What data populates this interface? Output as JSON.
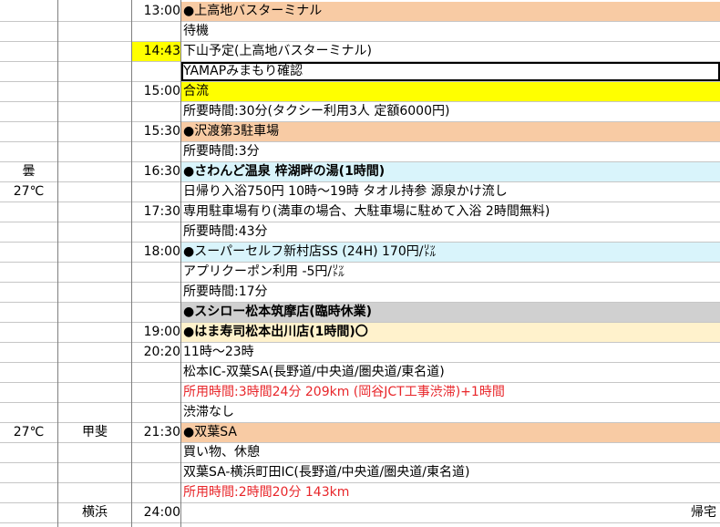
{
  "sheet": {
    "rows": [
      {
        "c1": "",
        "c2": "",
        "time": "13:00",
        "text": "●上高地バスターミナル",
        "fill": "#f8cba4",
        "bold": false
      },
      {
        "c1": "",
        "c2": "",
        "time": "",
        "text": "待機",
        "fill": "",
        "bold": false
      },
      {
        "c1": "",
        "c2": "",
        "time": "14:43",
        "time_fill": "#ffff00",
        "text": "下山予定(上高地バスターミナル)",
        "fill": "",
        "bold": false
      },
      {
        "c1": "",
        "c2": "",
        "time": "",
        "text": "YAMAPみまもり確認",
        "fill": "",
        "bold": false,
        "boxed": true
      },
      {
        "c1": "",
        "c2": "",
        "time": "15:00",
        "text": "合流",
        "fill": "#ffff00",
        "bold": false
      },
      {
        "c1": "",
        "c2": "",
        "time": "",
        "text": "所要時間:30分(タクシー利用3人 定額6000円)",
        "fill": "",
        "bold": false
      },
      {
        "c1": "",
        "c2": "",
        "time": "15:30",
        "text": "●沢渡第3駐車場",
        "fill": "#f8cba4",
        "bold": false
      },
      {
        "c1": "",
        "c2": "",
        "time": "",
        "text": "所要時間:3分",
        "fill": "",
        "bold": false
      },
      {
        "c1": "曇",
        "c2": "",
        "time": "16:30",
        "text": "●さわんど温泉 梓湖畔の湯(1時間)",
        "fill": "#d9f4fb",
        "bold": true
      },
      {
        "c1": "27℃",
        "c2": "",
        "time": "",
        "text": "日帰り入浴750円 10時〜19時 タオル持参 源泉かけ流し",
        "fill": "",
        "bold": false
      },
      {
        "c1": "",
        "c2": "",
        "time": "17:30",
        "text": "専用駐車場有り(満車の場合、大駐車場に駐めて入浴 2時間無料)",
        "fill": "",
        "bold": false
      },
      {
        "c1": "",
        "c2": "",
        "time": "",
        "text": "所要時間:43分",
        "fill": "",
        "bold": false
      },
      {
        "c1": "",
        "c2": "",
        "time": "18:00",
        "text": "●スーパーセルフ新村店SS (24H) 170円/㍑",
        "fill": "#d9f4fb",
        "bold": false
      },
      {
        "c1": "",
        "c2": "",
        "time": "",
        "text": "アプリクーポン利用 -5円/㍑",
        "fill": "",
        "bold": false
      },
      {
        "c1": "",
        "c2": "",
        "time": "",
        "text": "所要時間:17分",
        "fill": "",
        "bold": false
      },
      {
        "c1": "",
        "c2": "",
        "time": "",
        "text": "●スシロー松本筑摩店(臨時休業)",
        "fill": "#d0d0d0",
        "bold": true
      },
      {
        "c1": "",
        "c2": "",
        "time": "19:00",
        "text": "●はま寿司松本出川店(1時間)〇",
        "fill": "#fff2cc",
        "bold": true
      },
      {
        "c1": "",
        "c2": "",
        "time": "20:20",
        "text": "11時〜23時",
        "fill": "",
        "bold": false
      },
      {
        "c1": "",
        "c2": "",
        "time": "",
        "text": "松本IC-双葉SA(長野道/中央道/圏央道/東名道)",
        "fill": "",
        "bold": false
      },
      {
        "c1": "",
        "c2": "",
        "time": "",
        "text": "所用時間:3時間24分 209km (岡谷JCT工事渋滞)+1時間",
        "fill": "",
        "bold": false,
        "red": true
      },
      {
        "c1": "",
        "c2": "",
        "time": "",
        "text": "渋滞なし",
        "fill": "",
        "bold": false
      },
      {
        "c1": "27℃",
        "c2": "甲斐",
        "time": "21:30",
        "text": "●双葉SA",
        "fill": "#f8cba4",
        "bold": false
      },
      {
        "c1": "",
        "c2": "",
        "time": "",
        "text": "買い物、休憩",
        "fill": "",
        "bold": false
      },
      {
        "c1": "",
        "c2": "",
        "time": "",
        "text": "双葉SA-横浜町田IC(長野道/中央道/圏央道/東名道)",
        "fill": "",
        "bold": false
      },
      {
        "c1": "",
        "c2": "",
        "time": "",
        "text": "所用時間:2時間20分 143km",
        "fill": "",
        "bold": false,
        "red": true
      },
      {
        "c1": "",
        "c2": "横浜",
        "time": "24:00",
        "text": "",
        "fill": "",
        "bold": false,
        "right": "帰宅"
      }
    ]
  }
}
